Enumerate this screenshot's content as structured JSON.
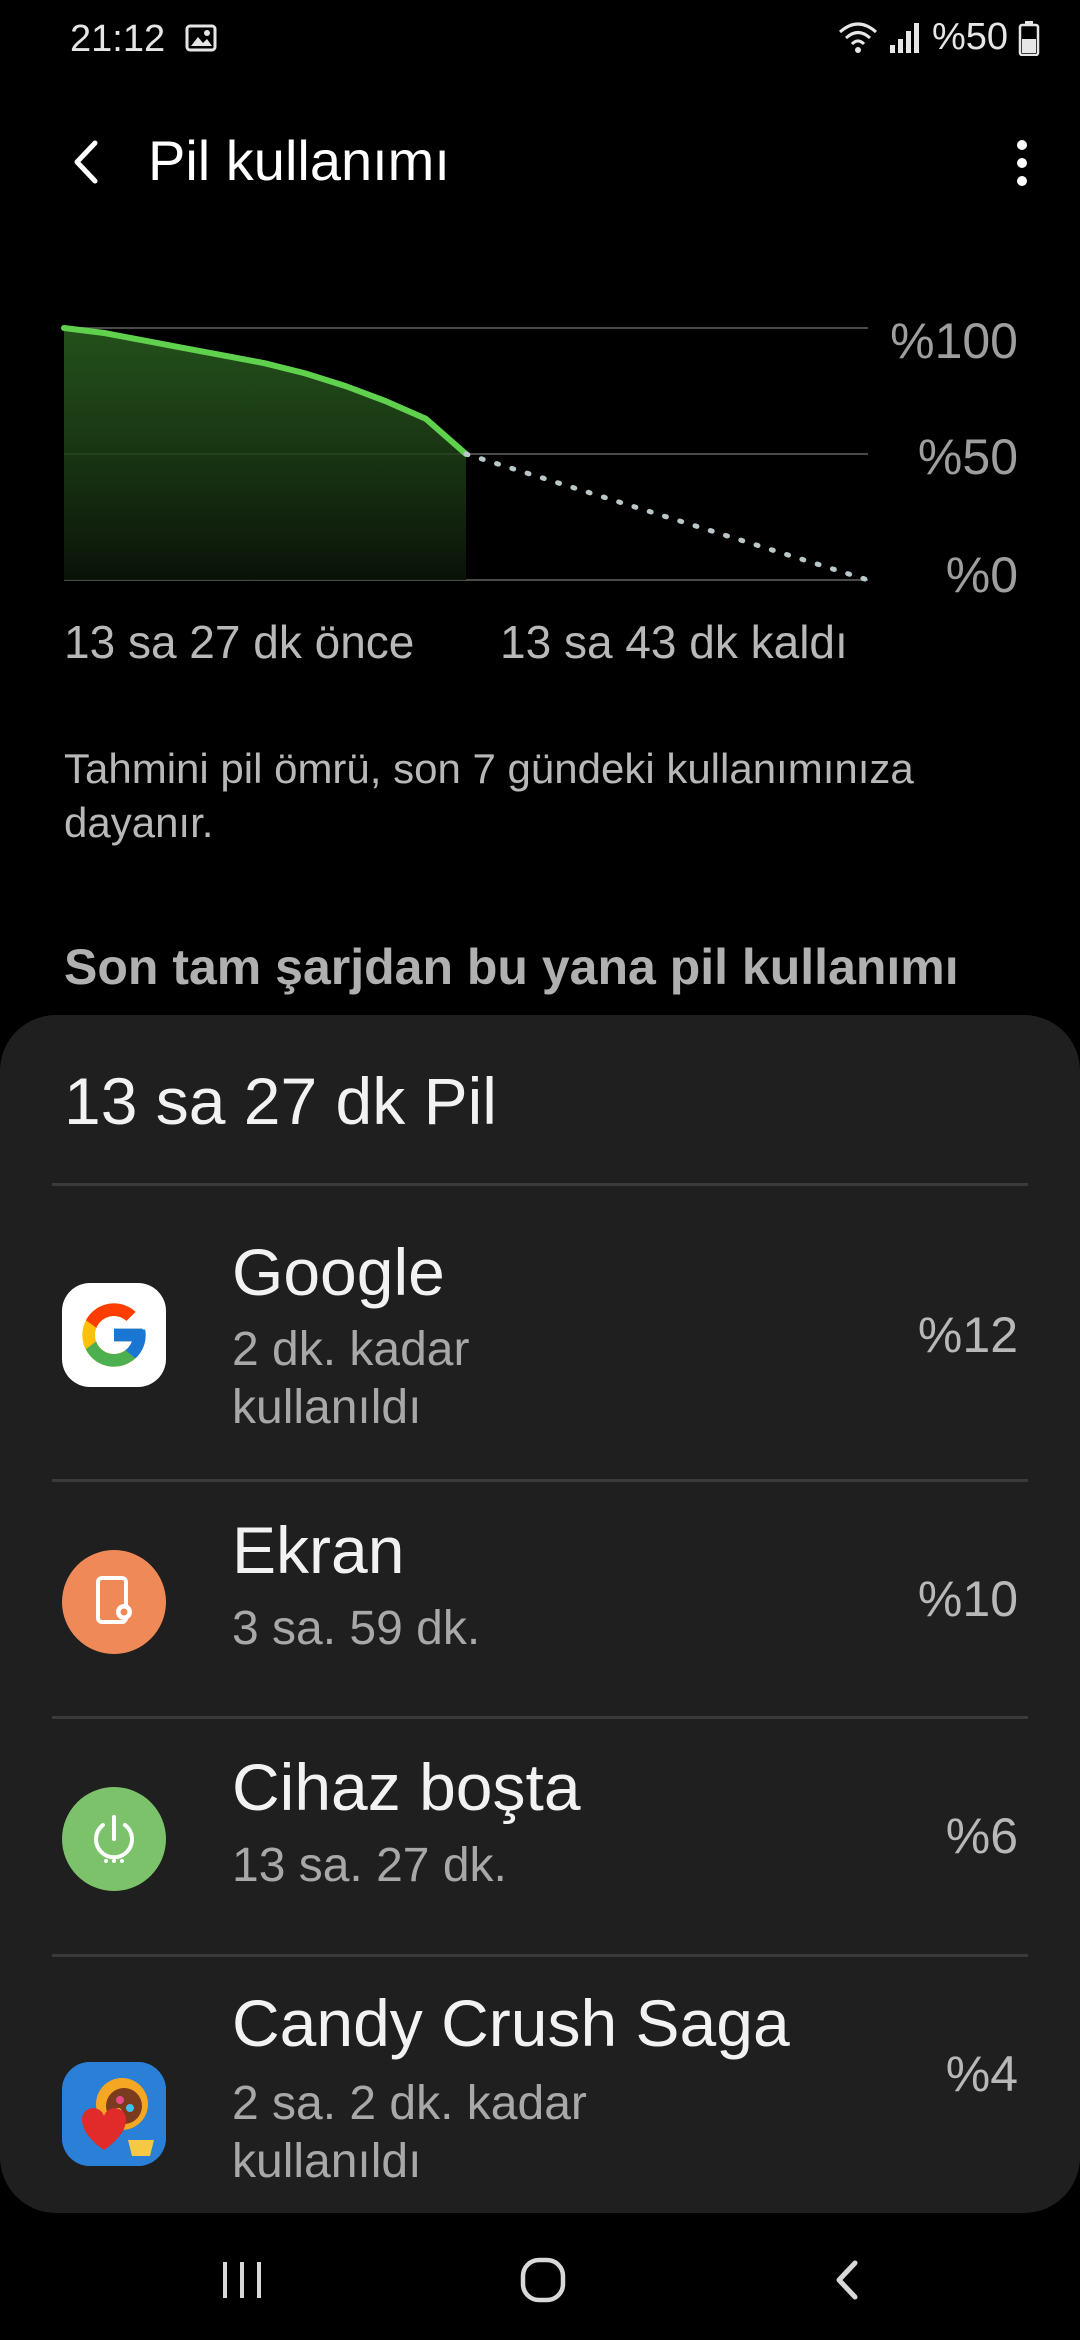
{
  "status_bar": {
    "time": "21:12",
    "battery_text": "%50",
    "icons": [
      "gallery-icon",
      "wifi-icon",
      "signal-icon",
      "battery-icon"
    ]
  },
  "app_bar": {
    "title": "Pil kullanımı",
    "back_icon": "back-arrow-icon",
    "more_icon": "more-vert-icon"
  },
  "chart_data": {
    "type": "area",
    "title": "",
    "y_ticks": [
      "%100",
      "%50",
      "%0"
    ],
    "ylim": [
      0,
      100
    ],
    "time_labels": {
      "left": "13 sa 27 dk önce",
      "right": "13 sa 43 dk kaldı"
    },
    "actual": {
      "x": [
        0,
        5,
        10,
        15,
        20,
        25,
        30,
        35,
        40,
        45,
        50
      ],
      "y": [
        100,
        98,
        95,
        92,
        89,
        86,
        82,
        77,
        71,
        64,
        50
      ]
    },
    "projection": {
      "x": [
        50,
        100
      ],
      "y": [
        50,
        0
      ]
    },
    "colors": {
      "line": "#5fd14d",
      "projection": "#b9c7c8",
      "grid": "#4a4a4a"
    }
  },
  "description": "Tahmini pil ömrü, son 7 gündeki kullanımınıza dayanır.",
  "section_header": "Son tam şarjdan bu yana pil kullanımı",
  "sheet": {
    "title": "13 sa 27 dk Pil",
    "items": [
      {
        "name": "Google",
        "sub": "2 dk. kadar kullanıldı",
        "pct": "%12",
        "icon": "google-icon",
        "icon_bg": "#ffffff"
      },
      {
        "name": "Ekran",
        "sub": "3 sa. 59 dk.",
        "pct": "%10",
        "icon": "screen-icon",
        "icon_bg": "#ef8a58"
      },
      {
        "name": "Cihaz boşta",
        "sub": "13 sa. 27 dk.",
        "pct": "%6",
        "icon": "power-icon",
        "icon_bg": "#7bc26a"
      },
      {
        "name": "Candy Crush Saga",
        "sub": "2 sa. 2 dk. kadar kullanıldı",
        "pct": "%4",
        "icon": "candy-crush-icon",
        "icon_bg": "#2a7fd6"
      }
    ]
  },
  "nav_bar": {
    "icons": [
      "recents-icon",
      "home-icon",
      "back-nav-icon"
    ]
  }
}
